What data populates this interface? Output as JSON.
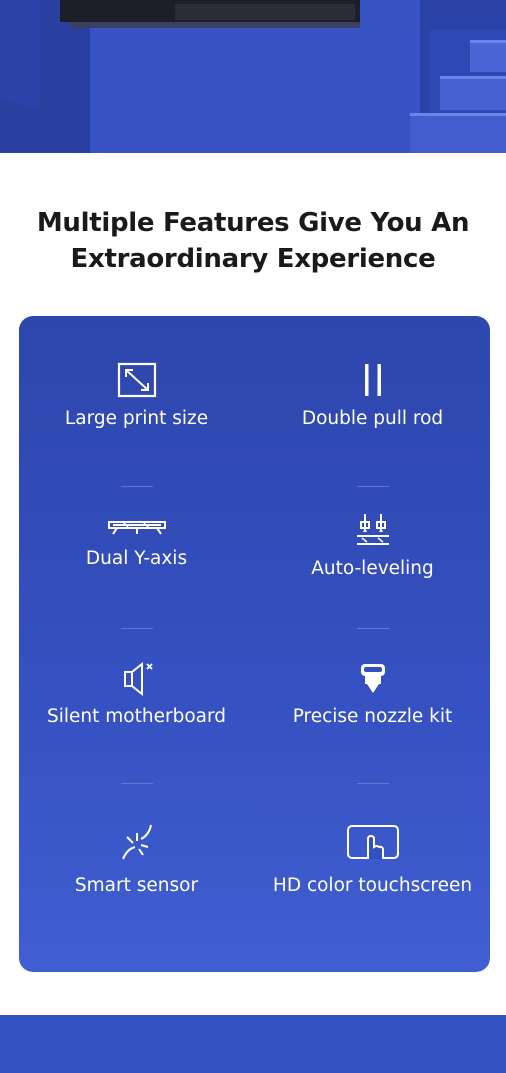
{
  "colors": {
    "accent": "#3550c0",
    "heading": "#1a1a1a",
    "card_text": "#ffffff"
  },
  "section": {
    "title_line1": "Multiple Features Give You An",
    "title_line2": "Extraordinary Experience"
  },
  "features": [
    {
      "icon": "resize-diagonal-icon",
      "label": "Large print size"
    },
    {
      "icon": "double-bar-icon",
      "label": "Double pull rod"
    },
    {
      "icon": "rail-icon",
      "label": "Dual Y-axis"
    },
    {
      "icon": "leveling-probe-icon",
      "label": "Auto-leveling"
    },
    {
      "icon": "speaker-mute-icon",
      "label": "Silent motherboard"
    },
    {
      "icon": "nozzle-icon",
      "label": "Precise nozzle kit"
    },
    {
      "icon": "sparkle-sensor-icon",
      "label": "Smart sensor"
    },
    {
      "icon": "touchscreen-hand-icon",
      "label": "HD color touchscreen"
    }
  ]
}
